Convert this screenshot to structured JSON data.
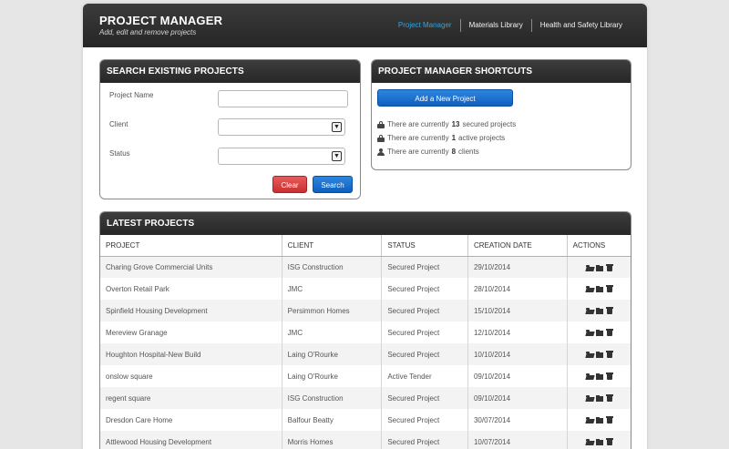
{
  "header": {
    "title": "PROJECT MANAGER",
    "subtitle": "Add, edit and remove projects",
    "nav": [
      {
        "label": "Project Manager",
        "active": true
      },
      {
        "label": "Materials Library",
        "active": false
      },
      {
        "label": "Health and Safety Library",
        "active": false
      }
    ]
  },
  "search": {
    "title": "SEARCH EXISTING PROJECTS",
    "project_name_label": "Project Name",
    "project_name_value": "",
    "client_label": "Client",
    "client_value": "",
    "status_label": "Status",
    "status_value": "",
    "clear_label": "Clear",
    "search_label": "Search"
  },
  "shortcuts": {
    "title": "PROJECT MANAGER SHORTCUTS",
    "add_button": "Add a New Project",
    "lines": [
      {
        "prefix": "There are currently",
        "count": "13",
        "suffix": "secured projects",
        "icon": "lock-icon"
      },
      {
        "prefix": "There are currently",
        "count": "1",
        "suffix": "active projects",
        "icon": "lock-icon"
      },
      {
        "prefix": "There are currently",
        "count": "8",
        "suffix": "clients",
        "icon": "user-icon"
      }
    ]
  },
  "latest": {
    "title": "LATEST PROJECTS",
    "columns": [
      "PROJECT",
      "CLIENT",
      "STATUS",
      "CREATION DATE",
      "ACTIONS"
    ],
    "rows": [
      {
        "project": "Charing Grove Commercial Units",
        "client": "ISG Construction",
        "status": "Secured Project",
        "date": "29/10/2014"
      },
      {
        "project": "Overton Retail Park",
        "client": "JMC",
        "status": "Secured Project",
        "date": "28/10/2014"
      },
      {
        "project": "Spinfield Housing Development",
        "client": "Persimmon Homes",
        "status": "Secured Project",
        "date": "15/10/2014"
      },
      {
        "project": "Mereview Granage",
        "client": "JMC",
        "status": "Secured Project",
        "date": "12/10/2014"
      },
      {
        "project": "Houghton Hospital-New Build",
        "client": "Laing O'Rourke",
        "status": "Secured Project",
        "date": "10/10/2014"
      },
      {
        "project": "onslow square",
        "client": "Laing O'Rourke",
        "status": "Active Tender",
        "date": "09/10/2014"
      },
      {
        "project": "regent square",
        "client": "ISG Construction",
        "status": "Secured Project",
        "date": "09/10/2014"
      },
      {
        "project": "Dresdon Care Home",
        "client": "Balfour Beatty",
        "status": "Secured Project",
        "date": "30/07/2014"
      },
      {
        "project": "Attlewood Housing Development",
        "client": "Morris Homes",
        "status": "Secured Project",
        "date": "10/07/2014"
      }
    ]
  }
}
